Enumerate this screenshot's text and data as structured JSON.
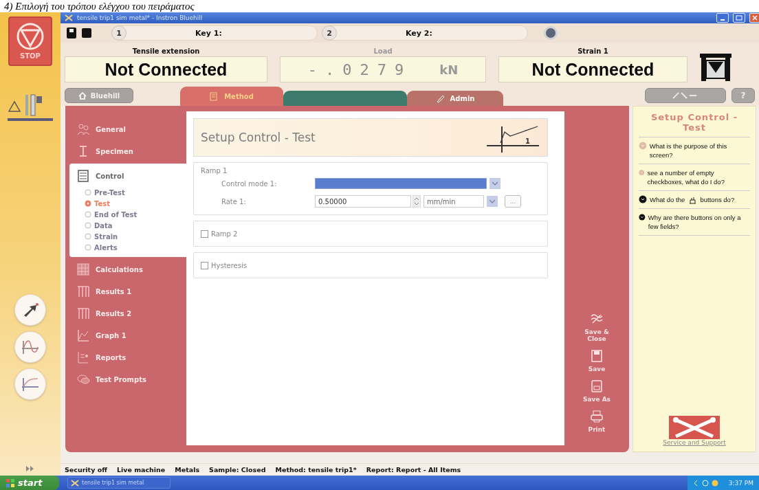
{
  "caption": "4) Επιλογή του τρόπου ελέγχου του πειράματος",
  "strip": {
    "stop_label": "STOP",
    "tools": [
      {
        "kind": "arrow"
      },
      {
        "kind": "wave"
      },
      {
        "kind": "curve"
      }
    ]
  },
  "window": {
    "title": "tensile trip1 sim metal* - Instron Bluehill"
  },
  "toolbar": {
    "keys": [
      {
        "number": "1",
        "label": "Key 1:"
      },
      {
        "number": "2",
        "label": "Key 2:"
      }
    ]
  },
  "readouts": [
    {
      "kind": "text",
      "label": "Tensile extension",
      "value": "Not Connected"
    },
    {
      "kind": "digits",
      "label": "Load",
      "value": "-.0279",
      "unit": "kN"
    },
    {
      "kind": "text",
      "label": "Strain 1",
      "value": "Not Connected"
    }
  ],
  "home_button": {
    "label": "Bluehill"
  },
  "tabs": [
    {
      "kind": "method",
      "label": "Method",
      "selected": true
    },
    {
      "kind": "blank",
      "selected": false
    },
    {
      "kind": "admin",
      "label": "Admin",
      "selected": false
    }
  ],
  "help_button": {
    "label": "?"
  },
  "nav": {
    "items": [
      {
        "kind": "general",
        "label": "General",
        "selected": false
      },
      {
        "kind": "specimen",
        "label": "Specimen",
        "selected": false
      },
      {
        "kind": "control",
        "label": "Control",
        "selected": true,
        "expanded": true,
        "children": [
          {
            "label": "Pre-Test",
            "selected": false
          },
          {
            "label": "Test",
            "selected": true
          },
          {
            "label": "End of Test",
            "selected": false
          },
          {
            "label": "Data",
            "selected": false
          },
          {
            "label": "Strain",
            "selected": false
          },
          {
            "label": "Alerts",
            "selected": false
          }
        ]
      },
      {
        "kind": "calculations",
        "label": "Calculations",
        "selected": false
      },
      {
        "kind": "results",
        "label": "Results 1",
        "selected": false
      },
      {
        "kind": "results",
        "label": "Results 2",
        "selected": false
      },
      {
        "kind": "graph",
        "label": "Graph 1",
        "selected": false
      },
      {
        "kind": "reports",
        "label": "Reports",
        "selected": false
      },
      {
        "kind": "prompts",
        "label": "Test Prompts",
        "selected": false
      }
    ]
  },
  "setup": {
    "title": "Setup Control - Test",
    "graph_label": "1",
    "ramp": {
      "label": "Ramp 1",
      "fields": [
        {
          "kind": "dropdown",
          "label": "Control mode 1:"
        },
        {
          "kind": "rate",
          "label": "Rate 1:",
          "value": "0.50000",
          "unit": "mm/min",
          "button": "..."
        }
      ]
    },
    "sections": [
      {
        "label": "Ramp 2",
        "checked": false
      },
      {
        "label": "Hysteresis",
        "checked": false
      }
    ]
  },
  "actions": [
    {
      "kind": "save_close",
      "label": "Save & Close"
    },
    {
      "kind": "save",
      "label": "Save"
    },
    {
      "kind": "save_as",
      "label": "Save As"
    },
    {
      "kind": "print",
      "label": "Print"
    }
  ],
  "help": {
    "title": "Setup Control - Test",
    "questions": [
      {
        "text": "What is the purpose of this screen?",
        "visited": true
      },
      {
        "text": "see a number of empty checkboxes, what do I do?",
        "visited": true
      },
      {
        "parts": [
          "What do the",
          "buttons do?"
        ],
        "visited": false
      },
      {
        "text": "Why are there buttons on only a few fields?",
        "visited": false
      }
    ],
    "link": "Service and Support"
  },
  "status_bar": [
    "Security off",
    "Live machine",
    "Metals",
    "Sample: Closed",
    "Method: tensile trip1*",
    "Report: Report - All Items"
  ],
  "taskbar": {
    "start": "start",
    "task": "tensile trip1 sim metal",
    "clock": "3:37 PM"
  }
}
